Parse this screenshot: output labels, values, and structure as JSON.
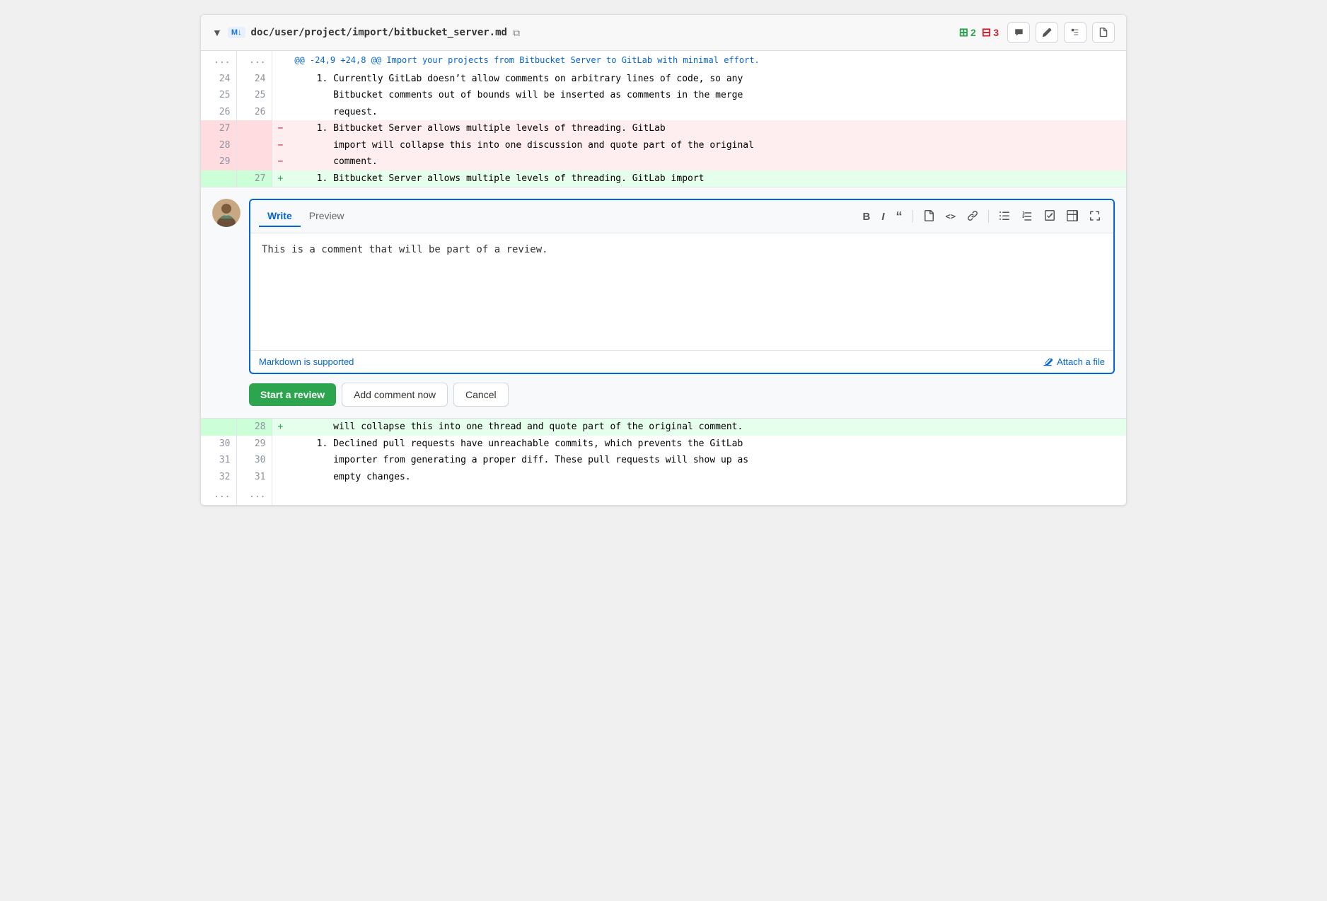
{
  "file": {
    "path": "doc/user/project/import/bitbucket_server.md",
    "added": 2,
    "removed": 3
  },
  "header": {
    "tabs": {
      "write": "Write",
      "preview": "Preview"
    },
    "tools": {
      "bold": "B",
      "italic": "I",
      "quote": "❝",
      "code_block": "◻",
      "inline_code": "<>",
      "link": "🔗",
      "bullet_list": "≡",
      "numbered_list": "≡",
      "task_list": "☑",
      "table": "⊞",
      "fullscreen": "⤢"
    }
  },
  "comment": {
    "text": "This is a comment that will be part of a review.",
    "markdown_hint": "Markdown is supported",
    "attach_file": "Attach a file"
  },
  "actions": {
    "start_review": "Start a review",
    "add_comment": "Add comment now",
    "cancel": "Cancel"
  },
  "diff": {
    "hunk_header": "@@ -24,9 +24,8 @@ Import your projects from Bitbucket Server to GitLab with minimal effort.",
    "lines": [
      {
        "old": "24",
        "new": "24",
        "type": "context",
        "sign": " ",
        "text": "    1. Currently GitLab doesn’t allow comments on arbitrary lines of code, so any"
      },
      {
        "old": "25",
        "new": "25",
        "type": "context",
        "sign": " ",
        "text": "       Bitbucket comments out of bounds will be inserted as comments in the merge"
      },
      {
        "old": "26",
        "new": "26",
        "type": "context",
        "sign": " ",
        "text": "       request."
      },
      {
        "old": "27",
        "new": "",
        "type": "removed",
        "sign": "-",
        "text": "    1. Bitbucket Server allows multiple levels of threading. GitLab"
      },
      {
        "old": "28",
        "new": "",
        "type": "removed",
        "sign": "-",
        "text": "       import will collapse this into one discussion and quote part of the original"
      },
      {
        "old": "29",
        "new": "",
        "type": "removed",
        "sign": "-",
        "text": "       comment."
      },
      {
        "old": "",
        "new": "27",
        "type": "added",
        "sign": "+",
        "text": "    1. Bitbucket Server allows multiple levels of threading. GitLab import"
      }
    ],
    "bottom_lines": [
      {
        "old": "",
        "new": "28",
        "type": "added",
        "sign": "+",
        "text": "       will collapse this into one thread and quote part of the original comment."
      },
      {
        "old": "30",
        "new": "29",
        "type": "context",
        "sign": " ",
        "text": "    1. Declined pull requests have unreachable commits, which prevents the GitLab"
      },
      {
        "old": "31",
        "new": "30",
        "type": "context",
        "sign": " ",
        "text": "       importer from generating a proper diff. These pull requests will show up as"
      },
      {
        "old": "32",
        "new": "31",
        "type": "context",
        "sign": " ",
        "text": "       empty changes."
      }
    ]
  }
}
